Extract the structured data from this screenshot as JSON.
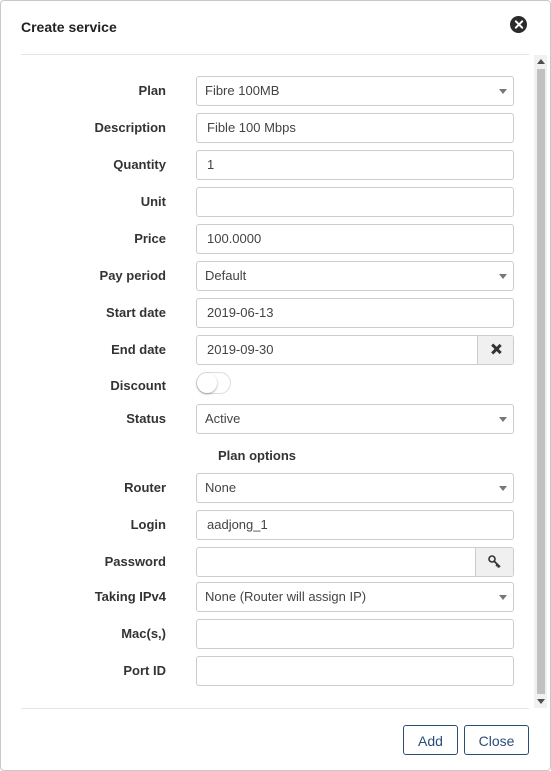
{
  "dialog": {
    "title": "Create service",
    "close_icon": "close-circle-icon"
  },
  "form": {
    "plan": {
      "label": "Plan",
      "value": "Fibre 100MB"
    },
    "description": {
      "label": "Description",
      "value": "Fible 100 Mbps"
    },
    "quantity": {
      "label": "Quantity",
      "value": "1"
    },
    "unit": {
      "label": "Unit",
      "value": ""
    },
    "price": {
      "label": "Price",
      "value": "100.0000"
    },
    "pay_period": {
      "label": "Pay period",
      "value": "Default"
    },
    "start_date": {
      "label": "Start date",
      "value": "2019-06-13"
    },
    "end_date": {
      "label": "End date",
      "value": "2019-09-30",
      "clear_icon": "times-icon"
    },
    "discount": {
      "label": "Discount",
      "enabled": false
    },
    "status": {
      "label": "Status",
      "value": "Active"
    },
    "plan_options_heading": "Plan options",
    "router": {
      "label": "Router",
      "value": "None"
    },
    "login": {
      "label": "Login",
      "value": "aadjong_1"
    },
    "password": {
      "label": "Password",
      "value": "",
      "generate_icon": "key-icon"
    },
    "taking_ipv4": {
      "label": "Taking IPv4",
      "value": "None (Router will assign IP)"
    },
    "macs": {
      "label": "Mac(s,)",
      "value": ""
    },
    "port_id": {
      "label": "Port ID",
      "value": ""
    }
  },
  "footer": {
    "add_label": "Add",
    "close_label": "Close"
  },
  "colors": {
    "button_border": "#2a4d7a",
    "label_text": "#333333",
    "field_border": "#cccccc"
  }
}
